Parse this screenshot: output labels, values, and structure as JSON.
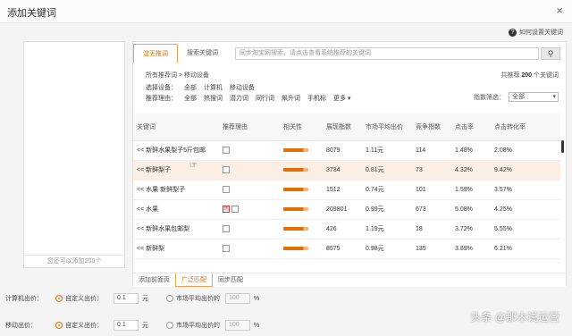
{
  "dialog": {
    "title": "添加关键词",
    "close": "×"
  },
  "help": {
    "text": "如何设置关键词",
    "icon": "?"
  },
  "left_panel": {
    "footer": "您还可以添加200个"
  },
  "tabs": [
    {
      "label": "淀无推词"
    },
    {
      "label": "搜索关键词"
    }
  ],
  "search": {
    "placeholder": "同步淘宝网搜索，请点击查看系统推荐的关键词",
    "button_icon": "search-icon"
  },
  "breadcrumb": "所有推荐词 > 移动设备",
  "total": {
    "prefix": "共推荐",
    "count": "200",
    "suffix": "个关键词"
  },
  "device_filter": {
    "label": "选择设备：",
    "options": [
      "全部",
      "计算机",
      "移动设备"
    ]
  },
  "reason_filter": {
    "label": "推荐理由：",
    "options": [
      "全部",
      "热搜词",
      "潜力词",
      "同行词",
      "飙升词",
      "手机标",
      "更多"
    ]
  },
  "index_filter": {
    "label": "指数筛选：",
    "value": "全部"
  },
  "table": {
    "headers": [
      "关键词",
      "推荐理由",
      "相关性",
      "展现指数",
      "市场平均出价",
      "竞争指数",
      "点击率",
      "点击转化率"
    ],
    "rows": [
      {
        "kw": "<< 新鲜水果梨子5斤包邮",
        "reason": "",
        "rel": "",
        "show": "8079",
        "price": "1.11元",
        "comp": "114",
        "ctr": "1.48%",
        "cvr": "2.08%"
      },
      {
        "kw": "<< 新鲜梨子",
        "reason": "",
        "rel": "",
        "show": "3734",
        "price": "0.81元",
        "comp": "73",
        "ctr": "4.32%",
        "cvr": "9.42%"
      },
      {
        "kw": "<< 水果 新鲜梨子",
        "reason": "",
        "rel": "",
        "show": "1512",
        "price": "0.74元",
        "comp": "101",
        "ctr": "1.59%",
        "cvr": "3.57%"
      },
      {
        "kw": "<< 水果",
        "reason": "",
        "rel": "",
        "show": "209801",
        "price": "0.99元",
        "comp": "673",
        "ctr": "5.08%",
        "cvr": "4.25%"
      },
      {
        "kw": "<< 新鲜水果包邮梨",
        "reason": "",
        "rel": "",
        "show": "426",
        "price": "1.19元",
        "comp": "18",
        "ctr": "3.72%",
        "cvr": "5.55%"
      },
      {
        "kw": "<< 新鲜梨",
        "reason": "",
        "rel": "",
        "show": "8575",
        "price": "0.98元",
        "comp": "135",
        "ctr": "3.89%",
        "cvr": "6.21%"
      }
    ]
  },
  "bottom_tabs": [
    "添加前面页",
    "广泛匹配",
    "同步匹配"
  ],
  "pc_bid": {
    "label": "计算机出价：",
    "custom": "自定义出价：",
    "value": "0.1",
    "unit": "元",
    "market": "市场平均出价的",
    "pct": "100",
    "pct_unit": "%"
  },
  "mobile_bid": {
    "label": "移动出价：",
    "custom": "自定义出价：",
    "value": "0.1",
    "unit": "元",
    "market": "市场平均出价的",
    "pct": "100",
    "pct_unit": "%"
  },
  "watermark": "头条 @那木说运营"
}
